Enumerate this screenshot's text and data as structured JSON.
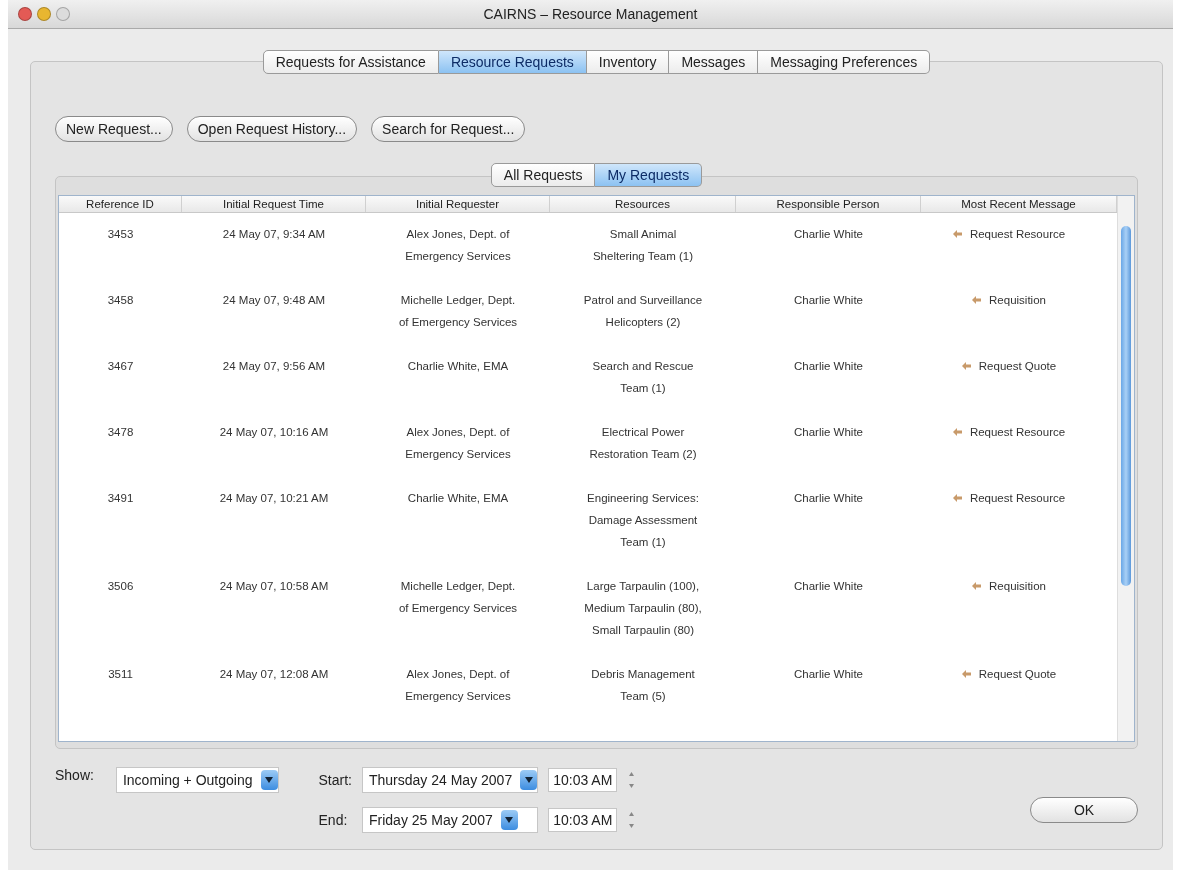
{
  "window": {
    "title": "CAIRNS – Resource Management"
  },
  "tabs": [
    {
      "label": "Requests for Assistance",
      "selected": false
    },
    {
      "label": "Resource Requests",
      "selected": true
    },
    {
      "label": "Inventory",
      "selected": false
    },
    {
      "label": "Messages",
      "selected": false
    },
    {
      "label": "Messaging Preferences",
      "selected": false
    }
  ],
  "actions": [
    "New Request...",
    "Open Request History...",
    "Search for Request..."
  ],
  "filter_tabs": [
    {
      "label": "All Requests",
      "selected": false
    },
    {
      "label": "My Requests",
      "selected": true
    }
  ],
  "table": {
    "columns": [
      "Reference ID",
      "Initial Request Time",
      "Initial Requester",
      "Resources",
      "Responsible Person",
      "Most Recent Message"
    ],
    "rows": [
      {
        "id": "3453",
        "time": "24 May 07, 9:34 AM",
        "requester": [
          "Alex Jones, Dept. of",
          "Emergency Services"
        ],
        "resources": [
          "Small Animal",
          "Sheltering Team (1)"
        ],
        "person": "Charlie White",
        "message": "Request Resource"
      },
      {
        "id": "3458",
        "time": "24 May 07, 9:48 AM",
        "requester": [
          "Michelle Ledger, Dept.",
          "of Emergency Services"
        ],
        "resources": [
          "Patrol and Surveillance",
          "Helicopters (2)"
        ],
        "person": "Charlie White",
        "message": "Requisition"
      },
      {
        "id": "3467",
        "time": "24 May 07, 9:56 AM",
        "requester": [
          "Charlie White, EMA"
        ],
        "resources": [
          "Search and Rescue",
          "Team (1)"
        ],
        "person": "Charlie White",
        "message": "Request Quote"
      },
      {
        "id": "3478",
        "time": "24 May 07, 10:16 AM",
        "requester": [
          "Alex Jones, Dept. of",
          "Emergency Services"
        ],
        "resources": [
          "Electrical Power",
          "Restoration Team (2)"
        ],
        "person": "Charlie White",
        "message": "Request Resource"
      },
      {
        "id": "3491",
        "time": "24 May 07, 10:21 AM",
        "requester": [
          "Charlie White, EMA"
        ],
        "resources": [
          "Engineering Services:",
          "Damage Assessment",
          "Team (1)"
        ],
        "person": "Charlie White",
        "message": "Request Resource"
      },
      {
        "id": "3506",
        "time": "24 May 07, 10:58 AM",
        "requester": [
          "Michelle Ledger, Dept.",
          "of Emergency Services"
        ],
        "resources": [
          "Large Tarpaulin (100),",
          "Medium Tarpaulin (80),",
          "Small Tarpaulin (80)"
        ],
        "person": "Charlie White",
        "message": "Requisition"
      },
      {
        "id": "3511",
        "time": "24 May 07, 12:08 AM",
        "requester": [
          "Alex Jones, Dept. of",
          "Emergency Services"
        ],
        "resources": [
          "Debris Management",
          "Team (5)"
        ],
        "person": "Charlie White",
        "message": "Request Quote"
      }
    ]
  },
  "show": {
    "label": "Show:",
    "value": "Incoming + Outgoing"
  },
  "start": {
    "label": "Start:",
    "date": "Thursday 24 May 2007",
    "time": "10:03 AM"
  },
  "end": {
    "label": "End:",
    "date": "Friday 25 May 2007",
    "time": "10:03 AM"
  },
  "ok_button": "OK"
}
